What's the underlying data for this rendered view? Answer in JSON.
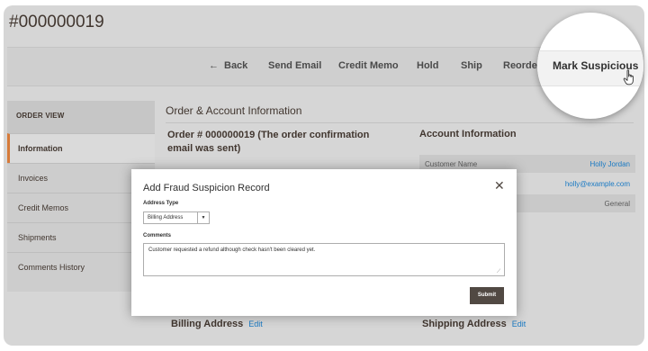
{
  "page": {
    "title": "#000000019"
  },
  "actions": {
    "back": "Back",
    "send_email": "Send Email",
    "credit_memo": "Credit Memo",
    "hold": "Hold",
    "ship": "Ship",
    "reorder": "Reorder",
    "mark_suspicious": "Mark Suspicious"
  },
  "sidebar": {
    "heading": "ORDER VIEW",
    "items": [
      {
        "label": "Information",
        "active": true
      },
      {
        "label": "Invoices",
        "active": false
      },
      {
        "label": "Credit Memos",
        "active": false
      },
      {
        "label": "Shipments",
        "active": false
      },
      {
        "label": "Comments History",
        "active": false
      }
    ]
  },
  "main": {
    "section_title": "Order & Account Information",
    "order_title": "Order # 000000019 (The order confirmation email was sent)",
    "account_title": "Account Information",
    "account_rows": [
      {
        "key": "Customer Name",
        "value": "Holly Jordan"
      },
      {
        "key": "",
        "value": "holly@example.com"
      },
      {
        "key": "",
        "value": "General"
      }
    ],
    "billing_title": "Billing Address",
    "shipping_title": "Shipping Address",
    "edit_label": "Edit"
  },
  "modal": {
    "title": "Add Fraud Suspicion Record",
    "address_type_label": "Address Type",
    "address_type_value": "Billing Address",
    "comments_label": "Comments",
    "comments_value": "Customer requested a refund although check hasn't been cleared yet.",
    "submit_label": "Submit"
  },
  "colors": {
    "accent": "#d67a39",
    "link": "#1979c3",
    "button": "#514943"
  },
  "icons": {
    "back": "arrow-left-icon",
    "close": "close-icon",
    "dropdown": "chevron-down-icon",
    "cursor": "hand-pointer-icon"
  }
}
